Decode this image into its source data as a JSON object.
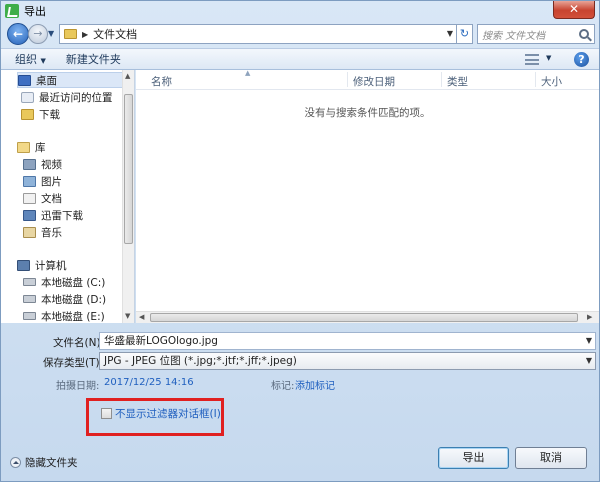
{
  "window": {
    "title": "导出",
    "close_label": "✕"
  },
  "address": {
    "crumb": "文件文档",
    "search_placeholder": "搜索 文件文档"
  },
  "toolbar": {
    "organize": "组织",
    "new_folder": "新建文件夹",
    "help": "?"
  },
  "nav": {
    "items": [
      {
        "label": "桌面",
        "icon": "desktop-icon"
      },
      {
        "label": "最近访问的位置",
        "icon": "recent-places-icon"
      },
      {
        "label": "下载",
        "icon": "downloads-folder-icon"
      },
      {
        "label": "库",
        "icon": "library-icon"
      },
      {
        "label": "视频",
        "icon": "videos-icon"
      },
      {
        "label": "图片",
        "icon": "pictures-icon"
      },
      {
        "label": "文档",
        "icon": "documents-icon"
      },
      {
        "label": "迅雷下载",
        "icon": "thunder-download-icon"
      },
      {
        "label": "音乐",
        "icon": "music-icon"
      },
      {
        "label": "计算机",
        "icon": "computer-icon"
      },
      {
        "label": "本地磁盘 (C:)",
        "icon": "disk-icon"
      },
      {
        "label": "本地磁盘 (D:)",
        "icon": "disk-icon"
      },
      {
        "label": "本地磁盘 (E:)",
        "icon": "disk-icon"
      }
    ]
  },
  "filelist": {
    "columns": [
      "名称",
      "修改日期",
      "类型",
      "大小"
    ],
    "empty_message": "没有与搜索条件匹配的项。"
  },
  "form": {
    "filename_label": "文件名(N):",
    "filename_value": "华盛最新LOGOlogo.jpg",
    "filetype_label": "保存类型(T):",
    "filetype_value": "JPG - JPEG 位图 (*.jpg;*.jtf;*.jff;*.jpeg)",
    "date_label": "拍摄日期:",
    "date_value": "2017/12/25 14:16",
    "tag_label": "标记:",
    "tag_value": "添加标记",
    "checkbox_label": "不显示过滤器对话框(I)"
  },
  "footer": {
    "hide_folders": "隐藏文件夹",
    "export_button": "导出",
    "cancel_button": "取消"
  }
}
